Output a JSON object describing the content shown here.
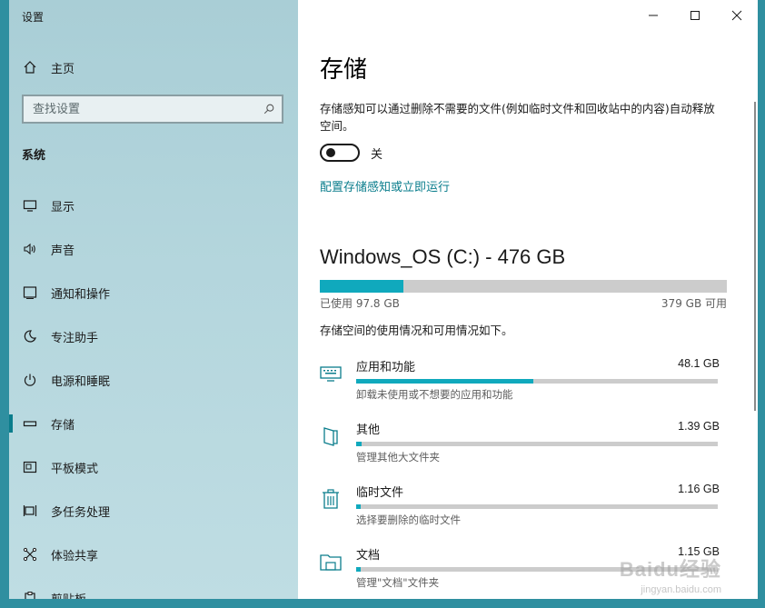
{
  "app": {
    "title": "设置"
  },
  "sidebar": {
    "home_label": "主页",
    "search_placeholder": "查找设置",
    "section_title": "系统",
    "items": [
      {
        "label": "显示",
        "icon": "monitor-icon"
      },
      {
        "label": "声音",
        "icon": "speaker-icon"
      },
      {
        "label": "通知和操作",
        "icon": "notification-icon"
      },
      {
        "label": "专注助手",
        "icon": "moon-icon"
      },
      {
        "label": "电源和睡眠",
        "icon": "power-icon"
      },
      {
        "label": "存储",
        "icon": "storage-icon",
        "active": true
      },
      {
        "label": "平板模式",
        "icon": "tablet-icon"
      },
      {
        "label": "多任务处理",
        "icon": "multitask-icon"
      },
      {
        "label": "体验共享",
        "icon": "share-icon"
      },
      {
        "label": "剪贴板",
        "icon": "clipboard-icon"
      }
    ]
  },
  "main": {
    "title": "存储",
    "description": "存储感知可以通过删除不需要的文件(例如临时文件和回收站中的内容)自动释放空间。",
    "toggle_state": "关",
    "config_link": "配置存储感知或立即运行",
    "drive": {
      "title": "Windows_OS (C:) - 476 GB",
      "used_label": "已使用 97.8 GB",
      "free_label": "379 GB 可用",
      "used_fraction": 0.205
    },
    "usage_intro": "存储空间的使用情况和可用情况如下。",
    "categories": [
      {
        "name": "应用和功能",
        "size": "48.1 GB",
        "sub": "卸载未使用或不想要的应用和功能",
        "fraction": 0.49,
        "icon": "keyboard-icon"
      },
      {
        "name": "其他",
        "size": "1.39 GB",
        "sub": "管理其他大文件夹",
        "fraction": 0.014,
        "icon": "document-icon"
      },
      {
        "name": "临时文件",
        "size": "1.16 GB",
        "sub": "选择要删除的临时文件",
        "fraction": 0.012,
        "icon": "trash-icon"
      },
      {
        "name": "文档",
        "size": "1.15 GB",
        "sub": "管理\"文档\"文件夹",
        "fraction": 0.012,
        "icon": "folder-icon"
      }
    ]
  },
  "watermark": {
    "text": "Baidu经验",
    "sub": "jingyan.baidu.com"
  },
  "colors": {
    "accent": "#0a7d8c",
    "bar_fill": "#10a9bd",
    "bar_track": "#cccccc"
  }
}
